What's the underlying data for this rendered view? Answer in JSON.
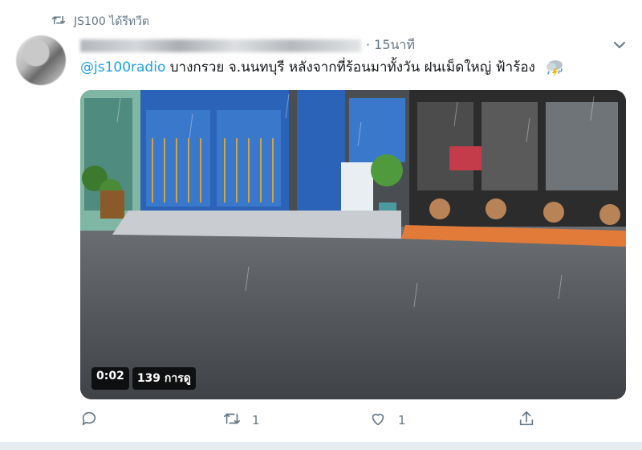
{
  "retweet": {
    "label": "JS100 ได้รีทวีต",
    "icon": "retweet-icon"
  },
  "tweet": {
    "time": "· 15นาที",
    "mention": "@js100radio",
    "text": " บางกรวย จ.นนทบุรี หลังจากที่ร้อนมาทั้งวัน ฝนเม็ดใหญ่ ฟ้าร้อง",
    "weather_icon": "thunderstorm-icon"
  },
  "video": {
    "duration": "0:02",
    "views": "139 การดู"
  },
  "actions": {
    "reply_count": "",
    "retweet_count": "1",
    "like_count": "1"
  },
  "colors": {
    "link": "#1da1f2",
    "muted": "#657786"
  }
}
